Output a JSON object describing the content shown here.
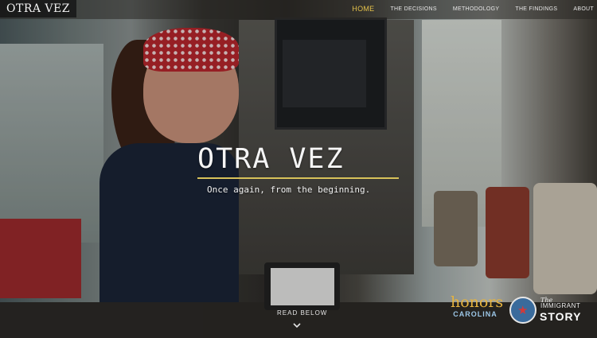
{
  "site": {
    "logo": "OTRA VEZ"
  },
  "nav": {
    "items": [
      {
        "label": "HOME",
        "active": true
      },
      {
        "label": "THE DECISIONS",
        "active": false
      },
      {
        "label": "METHODOLOGY",
        "active": false
      },
      {
        "label": "THE FINDINGS",
        "active": false
      },
      {
        "label": "ABOUT",
        "active": false
      }
    ]
  },
  "hero": {
    "title": "OTRA VEZ",
    "subtitle": "Once again, from the beginning."
  },
  "scroll": {
    "label": "READ BELOW",
    "icon": "chevron-down-icon"
  },
  "logos": {
    "honors_top": "honors",
    "honors_bottom": "CAROLINA",
    "immigrant_the": "The",
    "immigrant_name": "IMMIGRANT",
    "immigrant_story": "STORY",
    "immigrant_icon": "star-icon"
  },
  "colors": {
    "accent": "#e3c14a",
    "rule": "#d7c25a",
    "honors_gold": "#e6b33f",
    "honors_blue": "#9cc7e7"
  }
}
